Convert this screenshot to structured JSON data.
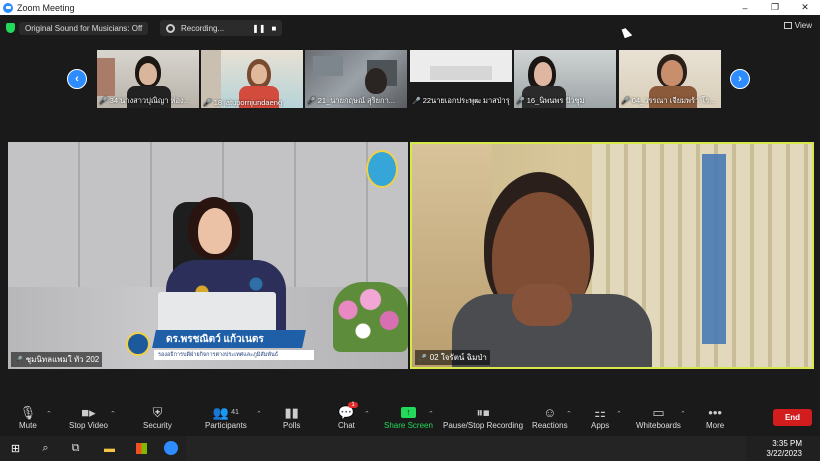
{
  "window": {
    "title": "Zoom Meeting",
    "controls": [
      "–",
      "❐",
      "✕"
    ]
  },
  "topbar": {
    "sound_label": "Original Sound for Musicians: Off",
    "recording_label": "Recording...",
    "pause_glyph": "❚❚",
    "stop_glyph": "■",
    "view_label": "View"
  },
  "nav": {
    "prev": "‹",
    "next": "›"
  },
  "thumbnails": [
    {
      "name": "34 นางสาวปุณิญา ห่อง..."
    },
    {
      "name": "18 jatupornjundaeng"
    },
    {
      "name": "21_นายกฤษณ์ สุริยกา..."
    },
    {
      "name": "22นายเอกประพุฒ มาสป่ารุง"
    },
    {
      "name": "16_นิพนพร ปัวชุม"
    },
    {
      "name": "04_วรรณา เจียมพร้า โร..."
    }
  ],
  "main_left": {
    "name": "ชุมนิทลแพมใ ทัว 202",
    "banner_title": "ดร.พรชณิตว์ แก้วเนตร",
    "banner_sub": "รองอธิการบดีฝ่ายกิจการต่างประเทศและภูมิสัมพันธ์"
  },
  "main_right": {
    "name": "02 ใจรัตน์ ฉิมป่า"
  },
  "toolbar": {
    "items": [
      {
        "label": "Mute",
        "icon": "microphone-icon"
      },
      {
        "label": "Stop Video",
        "icon": "video-camera-icon"
      },
      {
        "label": "Security",
        "icon": "shield-icon"
      },
      {
        "label": "Participants",
        "icon": "participants-icon",
        "count": "41"
      },
      {
        "label": "Polls",
        "icon": "polls-icon"
      },
      {
        "label": "Chat",
        "icon": "chat-icon",
        "badge": "1"
      },
      {
        "label": "Share Screen",
        "icon": "share-screen-icon"
      },
      {
        "label": "Pause/Stop Recording",
        "icon": "recording-controls-icon"
      },
      {
        "label": "Reactions",
        "icon": "reactions-icon"
      },
      {
        "label": "Apps",
        "icon": "apps-icon"
      },
      {
        "label": "Whiteboards",
        "icon": "whiteboard-icon"
      },
      {
        "label": "More",
        "icon": "more-icon"
      }
    ],
    "end_label": "End"
  },
  "taskbar": {
    "time": "3:35 PM",
    "date": "3/22/2023"
  },
  "colors": {
    "accent": "#2d8cff",
    "share": "#23d959",
    "end": "#d11d1d",
    "active_speaker_border": "#d6e84b"
  }
}
